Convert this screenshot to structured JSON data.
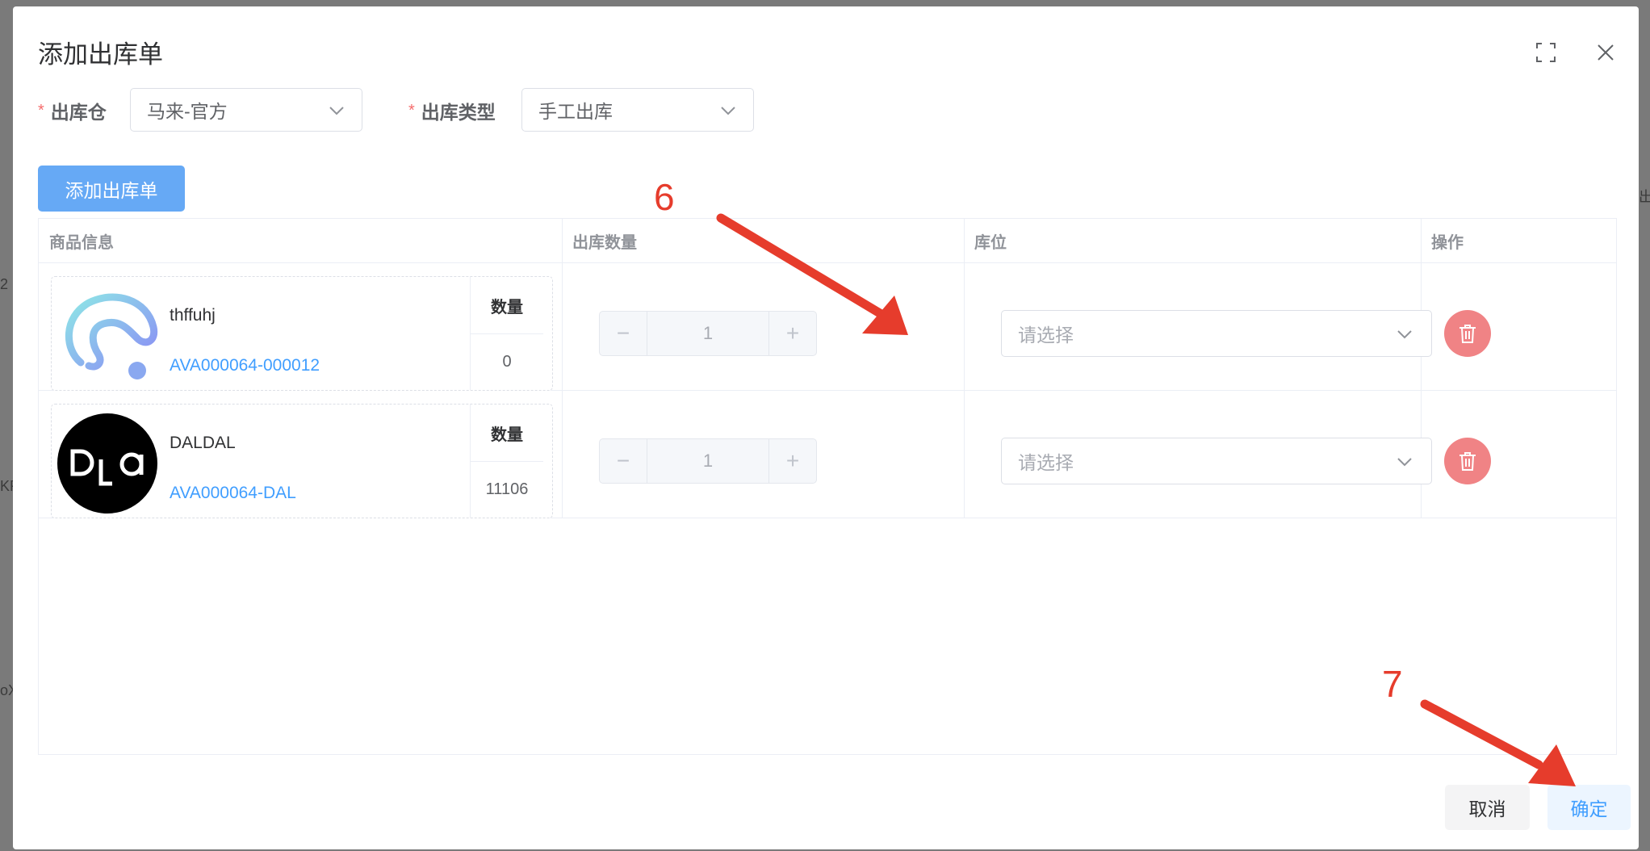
{
  "background": {
    "fragments": [
      "2",
      "KF",
      "oX",
      "出"
    ]
  },
  "dialog": {
    "title": "添加出库单",
    "warehouse": {
      "label": "出库仓",
      "value": "马来-官方"
    },
    "outbound_type": {
      "label": "出库类型",
      "value": "手工出库"
    },
    "add_button": "添加出库单",
    "table": {
      "headers": [
        "商品信息",
        "出库数量",
        "库位",
        "操作"
      ],
      "rows": [
        {
          "name": "thffuhj",
          "sku": "AVA000064-000012",
          "qty_label": "数量",
          "qty": "0",
          "out_qty": "1",
          "location_placeholder": "请选择"
        },
        {
          "name": "DALDAL",
          "sku": "AVA000064-DAL",
          "qty_label": "数量",
          "qty": "11106",
          "out_qty": "1",
          "location_placeholder": "请选择"
        }
      ]
    },
    "footer": {
      "cancel": "取消",
      "confirm": "确定"
    }
  },
  "annotations": [
    "6",
    "7"
  ],
  "colors": {
    "primary": "#409eff",
    "danger": "#f56c6c",
    "annotation": "#e63c2c"
  },
  "icons": [
    "fullscreen-icon",
    "close-icon",
    "chevron-down-icon",
    "trash-icon"
  ]
}
